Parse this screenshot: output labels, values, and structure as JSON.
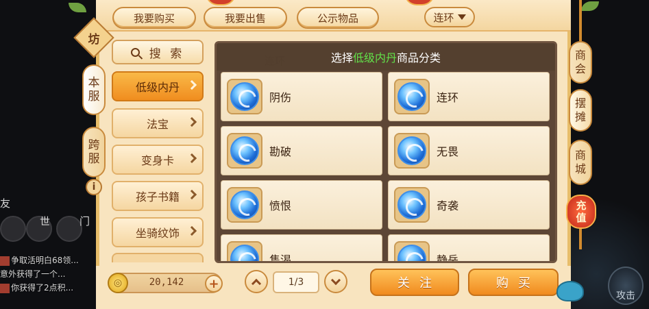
{
  "top_tabs": {
    "buy": "我要购买",
    "sell": "我要出售",
    "public": "公示物品"
  },
  "server_select": {
    "value": "连环"
  },
  "left_tabs": {
    "local_server": [
      "本",
      "服"
    ],
    "cross_server": [
      "跨",
      "服"
    ],
    "badge": "坊",
    "info": "i"
  },
  "search": {
    "label": "搜 索"
  },
  "categories": [
    {
      "label": "低级内丹",
      "active": true
    },
    {
      "label": "法宝",
      "active": false
    },
    {
      "label": "变身卡",
      "active": false
    },
    {
      "label": "孩子书籍",
      "active": false
    },
    {
      "label": "坐骑纹饰",
      "active": false
    }
  ],
  "grid": {
    "header_prefix": "选择",
    "header_highlight": "低级内丹",
    "header_suffix": "商品分类",
    "items": [
      {
        "name": "阴伤",
        "icon": "blue-orb-icon"
      },
      {
        "name": "连环",
        "icon": "blue-orb-icon"
      },
      {
        "name": "勘破",
        "icon": "blue-orb-icon"
      },
      {
        "name": "无畏",
        "icon": "blue-orb-icon"
      },
      {
        "name": "愤恨",
        "icon": "blue-orb-icon"
      },
      {
        "name": "奇袭",
        "icon": "blue-orb-icon"
      },
      {
        "name": "隽渴",
        "icon": "blue-orb-icon"
      },
      {
        "name": "静岳",
        "icon": "blue-orb-icon"
      }
    ]
  },
  "currency": {
    "amount": "20,142",
    "add": "+"
  },
  "pagination": {
    "indicator": "1/3"
  },
  "actions": {
    "follow": "关注",
    "buy": "购买"
  },
  "right_tabs": {
    "chamber": [
      "商",
      "会"
    ],
    "stall": [
      "摆",
      "摊"
    ],
    "mall": [
      "商",
      "城"
    ],
    "recharge": [
      "充",
      "值"
    ]
  },
  "background": {
    "chat_lines": [
      "争取活明白68领...",
      "意外获得了一个...",
      "你获得了2点积..."
    ],
    "attack_label": "攻击",
    "ghost_labels": [
      "连环",
      "友",
      "世",
      "门"
    ]
  },
  "colors": {
    "accent_orange": "#f08d1f",
    "highlight_green": "#62e24a",
    "panel_bg": "#f8e4bf",
    "frame_brown": "#5d4636"
  }
}
